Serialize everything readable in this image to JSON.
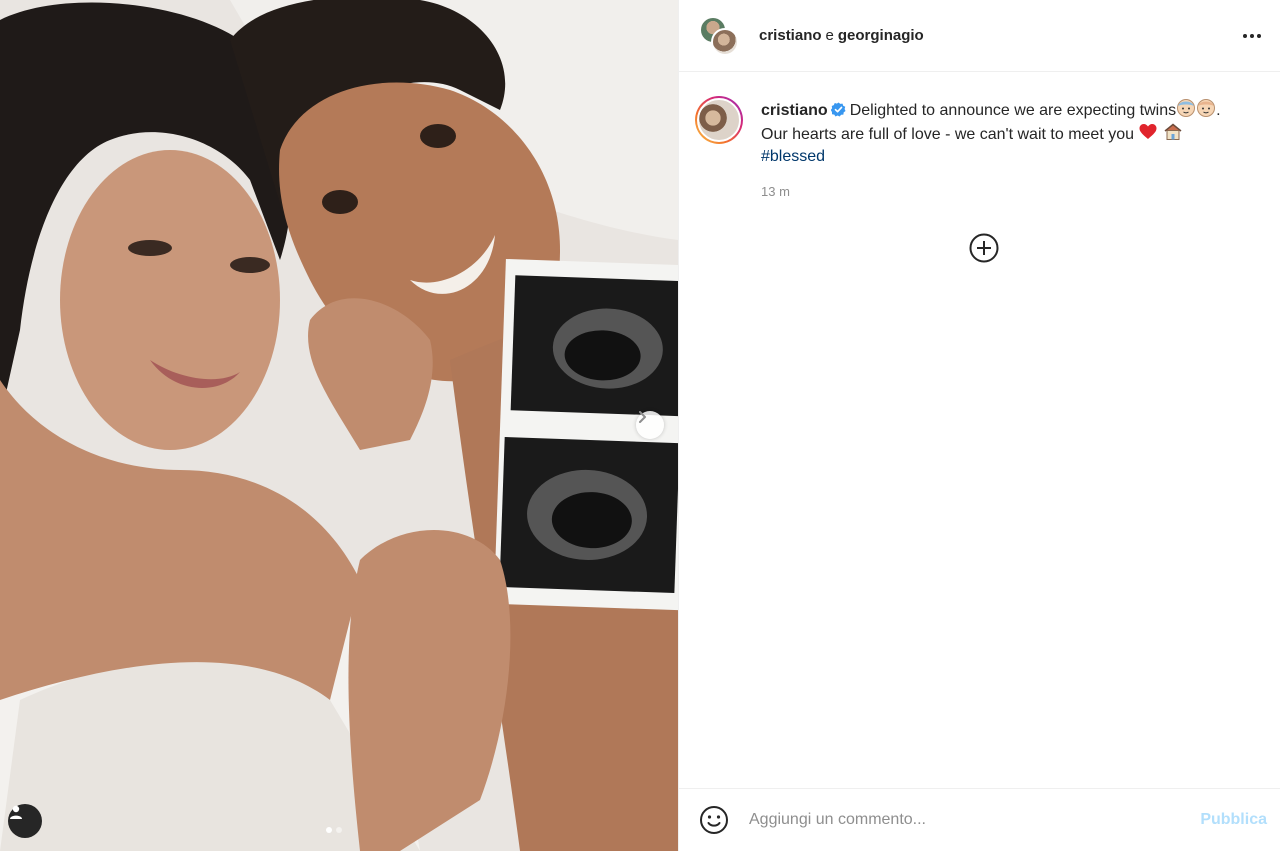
{
  "header": {
    "user1": "cristiano",
    "separator": "e",
    "user2": "georginagio",
    "more_icon": "ellipsis-icon"
  },
  "caption": {
    "username": "cristiano",
    "text_line1": "Delighted to announce we are expecting twins",
    "text_line1_end": ".",
    "text_line2": "Our hearts are full of love - we can't wait to meet you",
    "hashtag": "#blessed",
    "timestamp": "13 m"
  },
  "comment": {
    "placeholder": "Aggiungi un commento...",
    "publish_label": "Pubblica"
  },
  "carousel": {
    "slide_count": 2,
    "active_index": 0
  },
  "colors": {
    "link_blue": "#00376b",
    "verified_blue": "#3897f0",
    "publish_disabled": "#b2dffc",
    "muted": "#8e8e8e"
  }
}
